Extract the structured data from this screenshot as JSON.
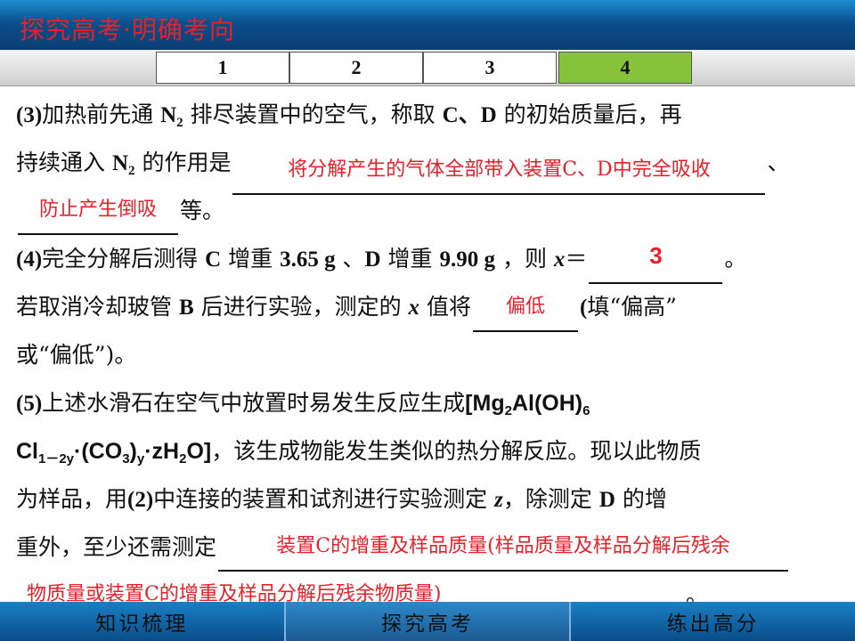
{
  "header": {
    "title": "探究高考·明确考向"
  },
  "tabs": [
    {
      "label": "1",
      "active": false
    },
    {
      "label": "2",
      "active": false
    },
    {
      "label": "3",
      "active": false
    },
    {
      "label": "4",
      "active": true
    }
  ],
  "q3": {
    "line1_a": "(3)",
    "line1_b": "加热前先通 ",
    "line1_n2": "N",
    "line1_n2_sub": "2",
    "line1_c": " 排尽装置中的空气，称取 ",
    "line1_cd": "C、D",
    "line1_d": " 的初始质量后，再",
    "line2_a": "持续通入 ",
    "line2_n2": "N",
    "line2_n2_sub": "2",
    "line2_b": " 的作用是",
    "answer1": "将分解产生的气体全部带入装置C、D中完全吸收",
    "line2_end": "、",
    "answer2": "防止产生倒吸",
    "line3_end": "等。"
  },
  "q4": {
    "line1_a": "(4)",
    "line1_b": "完全分解后测得 ",
    "line1_c": "C",
    "line1_d": " 增重 ",
    "line1_e": "3.65 g",
    "line1_f": " 、",
    "line1_g": "D",
    "line1_h": " 增重 ",
    "line1_i": "9.90 g",
    "line1_j": " ，则 ",
    "line1_x": "x",
    "line1_k": "＝",
    "answer_x": "3",
    "line1_end": "。",
    "line2_a": "若取消冷却玻管 ",
    "line2_b": "B",
    "line2_c": " 后进行实验，测定的 ",
    "line2_x": "x",
    "line2_d": " 值将",
    "answer_bias": "偏低",
    "line2_e": "(",
    "line2_f": "填“偏高”",
    "line3": "或“偏低”)。"
  },
  "q5": {
    "line1_a": "(5)",
    "line1_b": "上述水滑石在空气中放置时易发生反应生成",
    "formula1": "[Mg",
    "formula1_sub": "2",
    "formula2": "Al(OH)",
    "formula2_sub": "6",
    "formula3": "Cl",
    "formula3_sub": "1－2y",
    "formula4": "·(CO",
    "formula4_sub": "3",
    "formula5": ")",
    "formula5_sub": "y",
    "formula6": "·zH",
    "formula6_sub": "2",
    "formula7": "O]",
    "line2_text": "，该生成物能发生类似的热分解反应。现以此物质",
    "line3_a": "为样品，用",
    "line3_b": "(2)",
    "line3_c": "中连接的装置和试剂进行实验测定 ",
    "line3_z": "z",
    "line3_d": "，除测定 ",
    "line3_e": "D",
    "line3_f": " 的增",
    "line4_a": "重外，至少还需测定",
    "answer_a": "装置C的增重及样品质量(样品质量及样品分解后残余",
    "answer_b": "物质量或装置C的增重及样品分解后残余物质量)",
    "line5_end": "。"
  },
  "footer": {
    "items": [
      "知识梳理",
      "探究高考",
      "练出高分"
    ]
  },
  "colors": {
    "accent_red": "#e8202a",
    "tab_active": "#86c23a",
    "header_blue": "#0a4f8c"
  }
}
